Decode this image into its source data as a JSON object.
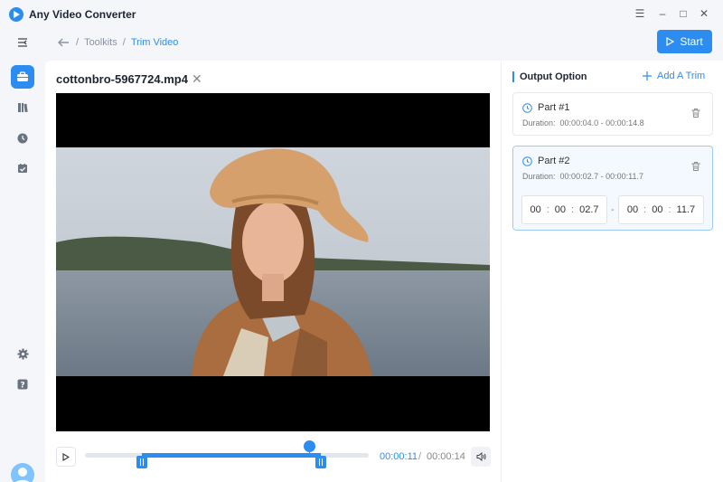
{
  "app": {
    "title": "Any Video Converter"
  },
  "window": {
    "menu": "☰",
    "minimize": "–",
    "maximize": "□",
    "close": "✕"
  },
  "breadcrumb": {
    "sep1": "/",
    "toolkits": "Toolkits",
    "sep2": "/",
    "current": "Trim Video"
  },
  "toolbar": {
    "start_label": "Start"
  },
  "file": {
    "name": "cottonbro-5967724.mp4",
    "close": "✕"
  },
  "player": {
    "current_time": "00:00:11",
    "separator": "/",
    "total_time": "00:00:14",
    "trim_start_fraction": 0.2,
    "trim_end_fraction": 0.83,
    "playhead_fraction": 0.79
  },
  "output": {
    "title": "Output Option",
    "add_trim_label": "Add A Trim",
    "parts": [
      {
        "name": "Part #1",
        "duration_label": "Duration:",
        "duration": "00:00:04.0 - 00:00:14.8"
      },
      {
        "name": "Part #2",
        "duration_label": "Duration:",
        "duration": "00:00:02.7 - 00:00:11.7",
        "start": {
          "hh": "00",
          "mm": "00",
          "ss": "02.7"
        },
        "end": {
          "hh": "00",
          "mm": "00",
          "ss": "11.7"
        },
        "range_sep": "-"
      }
    ],
    "time_colon": ":"
  },
  "colors": {
    "accent": "#2d8cf0",
    "background": "#f4f6fa"
  }
}
